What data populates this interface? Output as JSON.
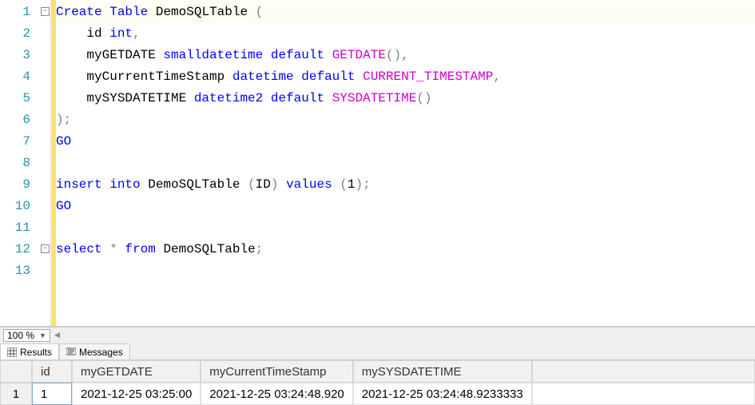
{
  "zoom": "100 %",
  "code": {
    "lines": [
      {
        "n": 1,
        "hl": true,
        "fold": "minus",
        "tokens": [
          {
            "t": "Create",
            "c": "kw"
          },
          {
            "t": " ",
            "c": "plain"
          },
          {
            "t": "Table",
            "c": "kw"
          },
          {
            "t": " DemoSQLTable ",
            "c": "plain"
          },
          {
            "t": "(",
            "c": "gray"
          }
        ]
      },
      {
        "n": 2,
        "tokens": [
          {
            "t": "    id ",
            "c": "plain"
          },
          {
            "t": "int",
            "c": "kw"
          },
          {
            "t": ",",
            "c": "gray"
          }
        ]
      },
      {
        "n": 3,
        "tokens": [
          {
            "t": "    myGETDATE ",
            "c": "plain"
          },
          {
            "t": "smalldatetime",
            "c": "kw"
          },
          {
            "t": " ",
            "c": "plain"
          },
          {
            "t": "default",
            "c": "kw"
          },
          {
            "t": " ",
            "c": "plain"
          },
          {
            "t": "GETDATE",
            "c": "func"
          },
          {
            "t": "(),",
            "c": "gray"
          }
        ]
      },
      {
        "n": 4,
        "tokens": [
          {
            "t": "    myCurrentTimeStamp ",
            "c": "plain"
          },
          {
            "t": "datetime",
            "c": "kw"
          },
          {
            "t": " ",
            "c": "plain"
          },
          {
            "t": "default",
            "c": "kw"
          },
          {
            "t": " ",
            "c": "plain"
          },
          {
            "t": "CURRENT_TIMESTAMP",
            "c": "func"
          },
          {
            "t": ",",
            "c": "gray"
          }
        ]
      },
      {
        "n": 5,
        "tokens": [
          {
            "t": "    mySYSDATETIME ",
            "c": "plain"
          },
          {
            "t": "datetime2",
            "c": "kw"
          },
          {
            "t": " ",
            "c": "plain"
          },
          {
            "t": "default",
            "c": "kw"
          },
          {
            "t": " ",
            "c": "plain"
          },
          {
            "t": "SYSDATETIME",
            "c": "func"
          },
          {
            "t": "()",
            "c": "gray"
          }
        ]
      },
      {
        "n": 6,
        "tokens": [
          {
            "t": ");",
            "c": "gray"
          }
        ]
      },
      {
        "n": 7,
        "tokens": [
          {
            "t": "GO",
            "c": "kw"
          }
        ]
      },
      {
        "n": 8,
        "tokens": [
          {
            "t": "",
            "c": "plain"
          }
        ]
      },
      {
        "n": 9,
        "tokens": [
          {
            "t": "insert",
            "c": "kw"
          },
          {
            "t": " ",
            "c": "plain"
          },
          {
            "t": "into",
            "c": "kw"
          },
          {
            "t": " DemoSQLTable ",
            "c": "plain"
          },
          {
            "t": "(",
            "c": "gray"
          },
          {
            "t": "ID",
            "c": "plain"
          },
          {
            "t": ")",
            "c": "gray"
          },
          {
            "t": " ",
            "c": "plain"
          },
          {
            "t": "values",
            "c": "kw"
          },
          {
            "t": " ",
            "c": "plain"
          },
          {
            "t": "(",
            "c": "gray"
          },
          {
            "t": "1",
            "c": "plain"
          },
          {
            "t": ");",
            "c": "gray"
          }
        ]
      },
      {
        "n": 10,
        "tokens": [
          {
            "t": "GO",
            "c": "kw"
          }
        ]
      },
      {
        "n": 11,
        "tokens": [
          {
            "t": "",
            "c": "plain"
          }
        ]
      },
      {
        "n": 12,
        "fold": "minus",
        "tokens": [
          {
            "t": "select",
            "c": "kw"
          },
          {
            "t": " ",
            "c": "plain"
          },
          {
            "t": "*",
            "c": "gray"
          },
          {
            "t": " ",
            "c": "plain"
          },
          {
            "t": "from",
            "c": "kw"
          },
          {
            "t": " DemoSQLTable",
            "c": "plain"
          },
          {
            "t": ";",
            "c": "gray"
          }
        ]
      },
      {
        "n": 13,
        "tokens": [
          {
            "t": "",
            "c": "plain"
          }
        ]
      }
    ]
  },
  "tabs": {
    "results": "Results",
    "messages": "Messages"
  },
  "results": {
    "columns": [
      "id",
      "myGETDATE",
      "myCurrentTimeStamp",
      "mySYSDATETIME"
    ],
    "rows": [
      {
        "n": "1",
        "cells": [
          "1",
          "2021-12-25 03:25:00",
          "2021-12-25 03:24:48.920",
          "2021-12-25 03:24:48.9233333"
        ]
      }
    ]
  }
}
